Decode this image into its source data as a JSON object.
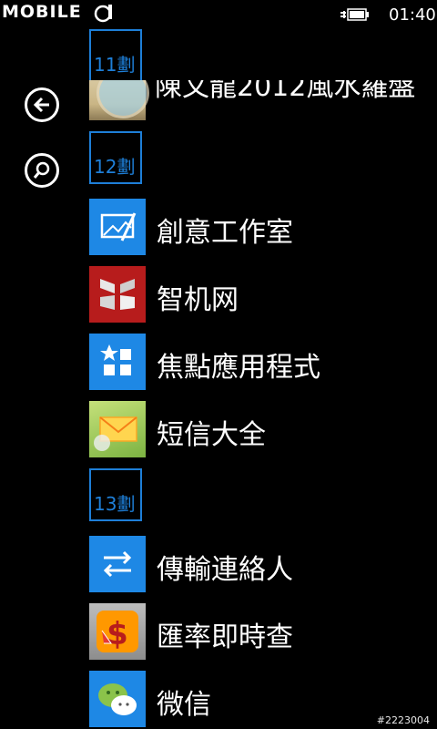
{
  "status_bar": {
    "brand": "MOBILE",
    "time": "01:40"
  },
  "sidebar": {
    "back_icon": "arrow-left-icon",
    "search_icon": "search-icon"
  },
  "app_list": {
    "partial_item_label": "陳文龍2012風水羅盤",
    "groups": [
      {
        "header": "11劃",
        "items": []
      },
      {
        "header": "12劃",
        "items": [
          {
            "label": "創意工作室",
            "icon": "photo-edit-icon",
            "tile_color": "#1e88e5"
          },
          {
            "label": "智机网",
            "icon": "zhiji-logo-icon",
            "tile_color": "#b71c1c"
          },
          {
            "label": "焦點應用程式",
            "icon": "app-grid-icon",
            "tile_color": "#1e88e5"
          },
          {
            "label": "短信大全",
            "icon": "envelope-icon",
            "tile_color": "#8bc34a"
          }
        ]
      },
      {
        "header": "13劃",
        "items": [
          {
            "label": "傳輸連絡人",
            "icon": "transfer-arrows-icon",
            "tile_color": "#1e88e5"
          },
          {
            "label": "匯率即時查",
            "icon": "currency-icon",
            "tile_color": "#9e9e9e"
          },
          {
            "label": "微信",
            "icon": "wechat-icon",
            "tile_color": "#1e88e5"
          }
        ]
      }
    ]
  },
  "watermark": "#2223004",
  "colors": {
    "accent": "#1e7fd8",
    "background": "#000000",
    "text": "#ffffff"
  }
}
